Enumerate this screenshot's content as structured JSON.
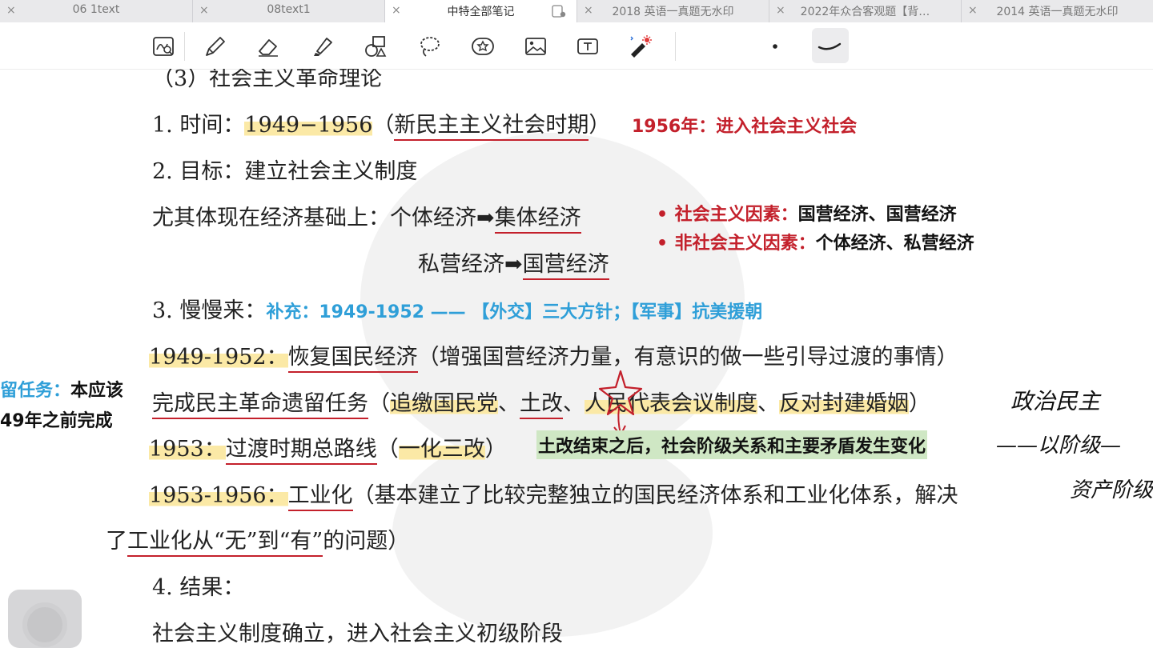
{
  "tabs": [
    {
      "label": "06 1text",
      "active": false
    },
    {
      "label": "08text1",
      "active": false
    },
    {
      "label": "中特全部笔记",
      "active": true
    },
    {
      "label": "2018 英语一真题无水印",
      "active": false
    },
    {
      "label": "2022年众合客观题【背…",
      "active": false
    },
    {
      "label": "2014 英语一真题无水印",
      "active": false
    }
  ],
  "tab_close_symbol": "×",
  "toolbar_icons": [
    "handwriting-zoom-icon",
    "pen-icon",
    "eraser-icon",
    "highlighter-icon",
    "shapes-icon",
    "lasso-icon",
    "sticker-icon",
    "image-icon",
    "textbox-icon",
    "laser-pointer-icon",
    "dot-size-icon",
    "pen-stroke-icon"
  ],
  "colors": {
    "accent_red": "#c3202b",
    "accent_blue": "#2f9fd8",
    "highlight_yellow": "#fbe9a6",
    "highlight_green": "#cfe7c4"
  },
  "doc": {
    "heading": "（3）社会主义革命理论",
    "item1": {
      "label": "1. 时间：",
      "years": "1949−1956",
      "period_pre": "（",
      "period": "新民主主义社会时期",
      "period_post": "）",
      "note": "1956年：进入社会主义社会"
    },
    "item2": {
      "label": "2. 目标：",
      "text": "建立社会主义制度"
    },
    "econ": {
      "intro": "尤其体现在经济基础上：个体经济",
      "arrow": "➡",
      "collective": "集体经济",
      "private": "私营经济",
      "state": "国营经济",
      "bullet": "•",
      "soc_label": "社会主义因素：",
      "soc_text": "国营经济、国营经济",
      "nonsoc_label": "非社会主义因素：",
      "nonsoc_text": "个体经济、私营经济"
    },
    "item3": {
      "label": "3. 慢慢来：",
      "supplement": "补充：1949-1952 —— 【外交】三大方针；【军事】抗美援朝"
    },
    "p1949": {
      "years": "1949-1952：",
      "task": "恢复国民经济",
      "rest": "（增强国营经济力量，有意识的做一些引导过渡的事情）"
    },
    "side_note": {
      "line1_blue": "留任务：",
      "line1_black": "本应该",
      "line2": "49年之前完成"
    },
    "democratic": {
      "main": "完成民主革命遗留任务",
      "open": "（",
      "a": "追缴国民党",
      "sep1": "、",
      "b": "土改",
      "sep2": "、",
      "c": "人民代表会议制度",
      "sep3": "、",
      "d": "反对封建婚姻",
      "close": "）"
    },
    "hand_political": "政治民主",
    "p1953": {
      "year": "1953：",
      "line": "过渡时期总路线",
      "open": "（",
      "change": "一化三改",
      "close": "）",
      "green_note": "土改结束之后，社会阶级关系和主要矛盾发生变化"
    },
    "hand_class": "——以阶级—",
    "hand_bourgeois": "资产阶级",
    "p1956": {
      "years": "1953-1956：",
      "main": "工业化",
      "rest": "（基本建立了比较完整独立的国民经济体系和工业化体系，解决"
    },
    "p1956b": {
      "pre": "了",
      "ul": "工业化从“无”到“有”",
      "post": "的问题）"
    },
    "item4": {
      "label": "4. 结果："
    },
    "result": "社会主义制度确立，进入社会主义初级阶段"
  }
}
